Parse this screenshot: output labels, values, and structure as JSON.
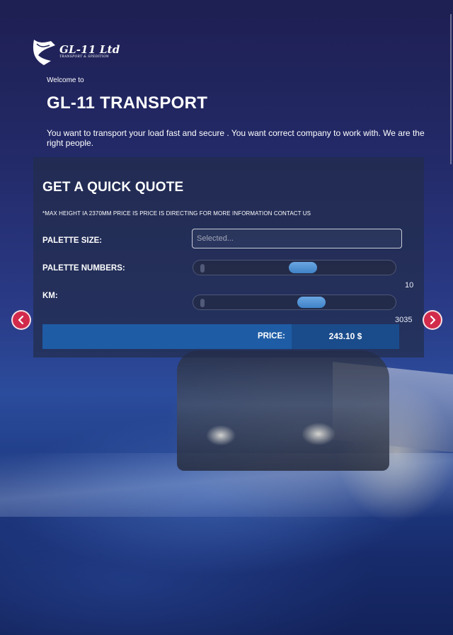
{
  "brand": {
    "name": "GL-11 Ltd",
    "tagline": "TRANSPORT & SPEDITION"
  },
  "hero": {
    "welcome": "Welcome to",
    "title": "GL-11 TRANSPORT",
    "description": "You want to transport your load fast and secure . You want correct company to work with. We are the right people."
  },
  "quote": {
    "title": "GET A QUICK QUOTE",
    "note": "*MAX HEIGHT IA 2370MM PRICE IS PRICE IS DIRECTING FOR MORE INFORMATION CONTACT US",
    "palette_size_label": "PALETTE SIZE:",
    "palette_size_placeholder": "Selected...",
    "palette_numbers_label": "PALETTE NUMBERS:",
    "palette_numbers_value": "10",
    "palette_numbers_level": 0.55,
    "km_label": "KM:",
    "km_value": "3035",
    "km_level": 0.6,
    "price_label": "PRICE:",
    "price_value": "243.10 $"
  },
  "carousel": {
    "prev_icon": "chevron-left-icon",
    "next_icon": "chevron-right-icon"
  },
  "colors": {
    "accent": "#d22a4a",
    "price_bar": "#1e5da6",
    "slider_handle": "#4f8fd2"
  }
}
